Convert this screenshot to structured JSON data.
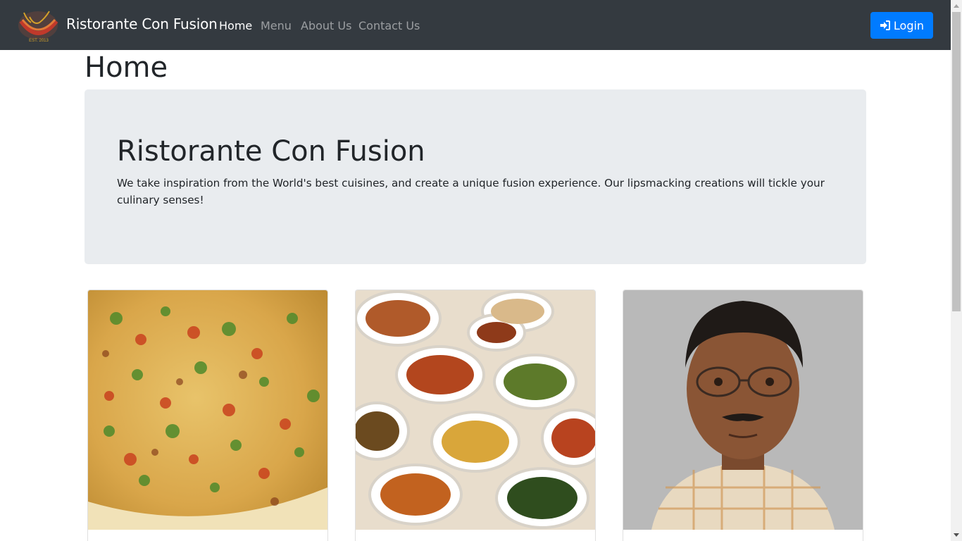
{
  "navbar": {
    "brand": "Ristorante Con Fusion",
    "logo_icon": "restaurant-logo",
    "nav_items": [
      {
        "label": "Home",
        "active": true
      },
      {
        "label": "Menu",
        "active": false
      },
      {
        "label": "About Us",
        "active": false
      },
      {
        "label": "Contact Us",
        "active": false
      }
    ],
    "login_label": "Login",
    "login_icon": "sign-in-icon"
  },
  "page": {
    "title": "Home"
  },
  "jumbotron": {
    "title": "Ristorante Con Fusion",
    "text": "We take inspiration from the World's best cuisines, and create a unique fusion experience. Our lipsmacking creations will tickle your culinary senses!"
  },
  "cards": [
    {
      "image": "pizza-photo"
    },
    {
      "image": "buffet-dishes-photo"
    },
    {
      "image": "chef-portrait-photo"
    }
  ],
  "colors": {
    "navbar_bg": "#343a40",
    "primary": "#007bff",
    "jumbotron_bg": "#e9ecef"
  }
}
